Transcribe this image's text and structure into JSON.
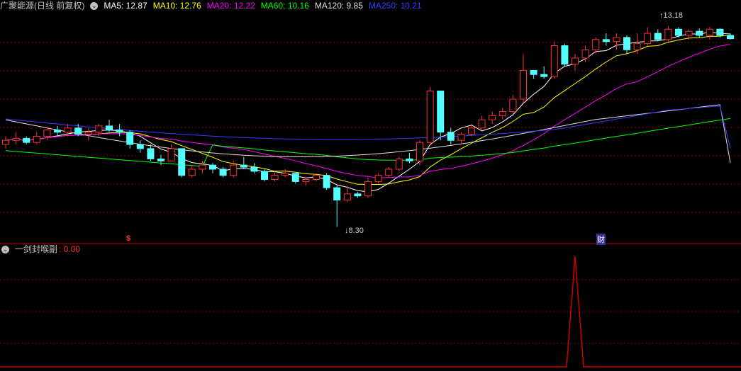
{
  "header": {
    "title": "广聚能源(日线 前复权)",
    "ma": [
      {
        "label": "MA5: 12.87",
        "color": "#ffffff"
      },
      {
        "label": "MA10: 12.76",
        "color": "#ffff00"
      },
      {
        "label": "MA20: 12.22",
        "color": "#ff00ff"
      },
      {
        "label": "MA60: 10.16",
        "color": "#00ff00"
      },
      {
        "label": "MA120: 9.85",
        "color": "#e0e0e0"
      },
      {
        "label": "MA250: 10.21",
        "color": "#3a3aff"
      }
    ]
  },
  "indicator": {
    "name": "一剑封喉副",
    "value": ": 0.00",
    "name_color": "#c0c0c0",
    "value_color": "#ff3030"
  },
  "annotations": {
    "high_price": "13.18",
    "low_price": "8.30",
    "event_marker_1": "$",
    "event_marker_2": "财"
  },
  "colors": {
    "up": "#ff3030",
    "down": "#54ffff",
    "grid": "#8b0000",
    "background": "#000000",
    "signal": "#d00000"
  },
  "chart_data": {
    "type": "candlestick",
    "ohlc": [
      [
        10.3,
        10.5,
        10.2,
        10.4
      ],
      [
        10.4,
        10.6,
        10.3,
        10.45
      ],
      [
        10.45,
        10.5,
        10.3,
        10.35
      ],
      [
        10.35,
        10.6,
        10.3,
        10.5
      ],
      [
        10.5,
        10.7,
        10.4,
        10.65
      ],
      [
        10.65,
        10.75,
        10.5,
        10.6
      ],
      [
        10.6,
        10.8,
        10.5,
        10.7
      ],
      [
        10.7,
        10.8,
        10.5,
        10.55
      ],
      [
        10.55,
        10.7,
        10.4,
        10.6
      ],
      [
        10.6,
        10.8,
        10.5,
        10.75
      ],
      [
        10.75,
        10.9,
        10.6,
        10.65
      ],
      [
        10.65,
        10.8,
        10.5,
        10.6
      ],
      [
        10.6,
        10.65,
        10.2,
        10.3
      ],
      [
        10.3,
        10.4,
        10.1,
        10.2
      ],
      [
        10.2,
        10.3,
        9.9,
        9.95
      ],
      [
        9.95,
        10.05,
        9.8,
        9.9
      ],
      [
        9.9,
        10.3,
        9.9,
        10.2
      ],
      [
        10.2,
        10.2,
        9.5,
        9.55
      ],
      [
        9.55,
        9.8,
        9.5,
        9.7
      ],
      [
        9.7,
        9.9,
        9.6,
        9.8
      ],
      [
        9.8,
        9.85,
        9.6,
        9.7
      ],
      [
        9.7,
        9.75,
        9.5,
        9.55
      ],
      [
        9.55,
        9.9,
        9.5,
        9.8
      ],
      [
        9.8,
        10.0,
        9.7,
        9.75
      ],
      [
        9.75,
        9.85,
        9.6,
        9.65
      ],
      [
        9.65,
        9.7,
        9.4,
        9.45
      ],
      [
        9.45,
        9.65,
        9.4,
        9.55
      ],
      [
        9.55,
        9.7,
        9.5,
        9.6
      ],
      [
        9.6,
        9.6,
        9.35,
        9.4
      ],
      [
        9.4,
        9.5,
        9.3,
        9.45
      ],
      [
        9.45,
        9.6,
        9.4,
        9.55
      ],
      [
        9.55,
        9.6,
        9.2,
        9.25
      ],
      [
        9.25,
        9.3,
        8.3,
        8.95
      ],
      [
        8.95,
        9.3,
        8.9,
        9.1
      ],
      [
        9.1,
        9.15,
        9.0,
        9.05
      ],
      [
        9.05,
        9.5,
        9.0,
        9.4
      ],
      [
        9.4,
        9.6,
        9.35,
        9.55
      ],
      [
        9.55,
        9.75,
        9.5,
        9.7
      ],
      [
        9.7,
        10.0,
        9.65,
        9.95
      ],
      [
        9.95,
        10.1,
        9.85,
        9.9
      ],
      [
        9.9,
        10.4,
        9.8,
        10.35
      ],
      [
        10.35,
        11.7,
        10.3,
        11.6
      ],
      [
        11.6,
        11.6,
        10.4,
        10.6
      ],
      [
        10.6,
        10.7,
        10.3,
        10.4
      ],
      [
        10.4,
        10.6,
        10.3,
        10.55
      ],
      [
        10.55,
        10.8,
        10.5,
        10.7
      ],
      [
        10.7,
        11.0,
        10.65,
        10.9
      ],
      [
        10.9,
        11.1,
        10.8,
        11.0
      ],
      [
        11.0,
        11.2,
        10.9,
        11.1
      ],
      [
        11.1,
        11.5,
        11.05,
        11.4
      ],
      [
        11.4,
        12.5,
        11.3,
        12.1
      ],
      [
        12.1,
        12.1,
        11.9,
        12.0
      ],
      [
        12.0,
        12.2,
        11.9,
        11.95
      ],
      [
        11.95,
        12.8,
        11.9,
        12.7
      ],
      [
        12.7,
        12.75,
        12.2,
        12.25
      ],
      [
        12.25,
        12.5,
        12.1,
        12.4
      ],
      [
        12.4,
        12.7,
        12.3,
        12.6
      ],
      [
        12.6,
        12.9,
        12.5,
        12.85
      ],
      [
        12.85,
        13.0,
        12.7,
        12.8
      ],
      [
        12.8,
        13.0,
        12.6,
        12.9
      ],
      [
        12.9,
        12.95,
        12.5,
        12.6
      ],
      [
        12.6,
        13.0,
        12.5,
        12.75
      ],
      [
        12.75,
        13.15,
        12.7,
        13.0
      ],
      [
        13.0,
        13.1,
        12.8,
        12.85
      ],
      [
        12.85,
        13.18,
        12.8,
        13.1
      ],
      [
        13.1,
        13.15,
        12.9,
        12.95
      ],
      [
        12.95,
        13.1,
        12.85,
        13.05
      ],
      [
        13.05,
        13.12,
        12.9,
        12.95
      ],
      [
        12.95,
        13.15,
        12.85,
        13.1
      ],
      [
        13.1,
        13.12,
        12.9,
        12.95
      ],
      [
        12.95,
        13.0,
        12.85,
        12.87
      ]
    ],
    "ma5_last": 12.87,
    "ma10_last": 12.76,
    "ma20_last": 12.22,
    "ma60_last": 10.16,
    "ma120_last": 9.85,
    "ma250_last": 10.21,
    "high": 13.18,
    "low": 8.3,
    "indicator_values_note": "value 0.00 except a single spike",
    "indicator_spike_index": 55
  }
}
